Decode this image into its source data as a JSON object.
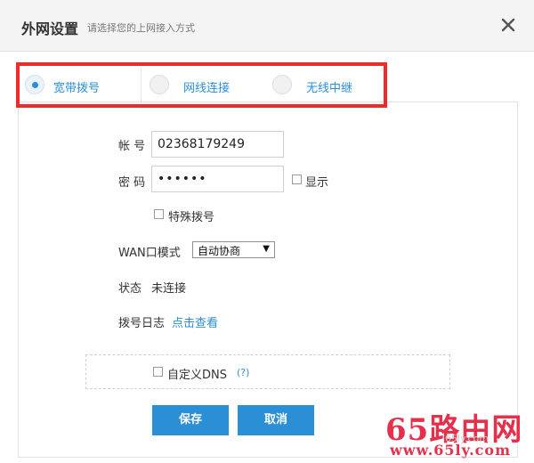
{
  "header": {
    "title": "外网设置",
    "subtitle": "请选择您的上网接入方式"
  },
  "tabs": [
    {
      "label": "宽带拨号",
      "selected": true
    },
    {
      "label": "网线连接",
      "selected": false
    },
    {
      "label": "无线中继",
      "selected": false
    }
  ],
  "form": {
    "account_label": "帐 号",
    "account_value": "02368179249",
    "password_label": "密 码",
    "password_value": "••••••",
    "show_label": "显示",
    "special_dial_label": "特殊拨号",
    "wan_mode_label": "WAN口模式",
    "wan_mode_value": "自动协商",
    "status_label": "状态",
    "status_value": "未连接",
    "dial_log_label": "拨号日志",
    "dial_log_link": "点击查看",
    "custom_dns_label": "自定义DNS",
    "help_mark": "(?)"
  },
  "buttons": {
    "save": "保存",
    "cancel": "取消"
  },
  "watermark": {
    "brand": "65路由网",
    "url": "www.65ly.com",
    "ghost": "65ly.com"
  },
  "colors": {
    "accent": "#2b8fd6",
    "highlight": "#ee2b2b",
    "watermark": "#e4304a"
  }
}
